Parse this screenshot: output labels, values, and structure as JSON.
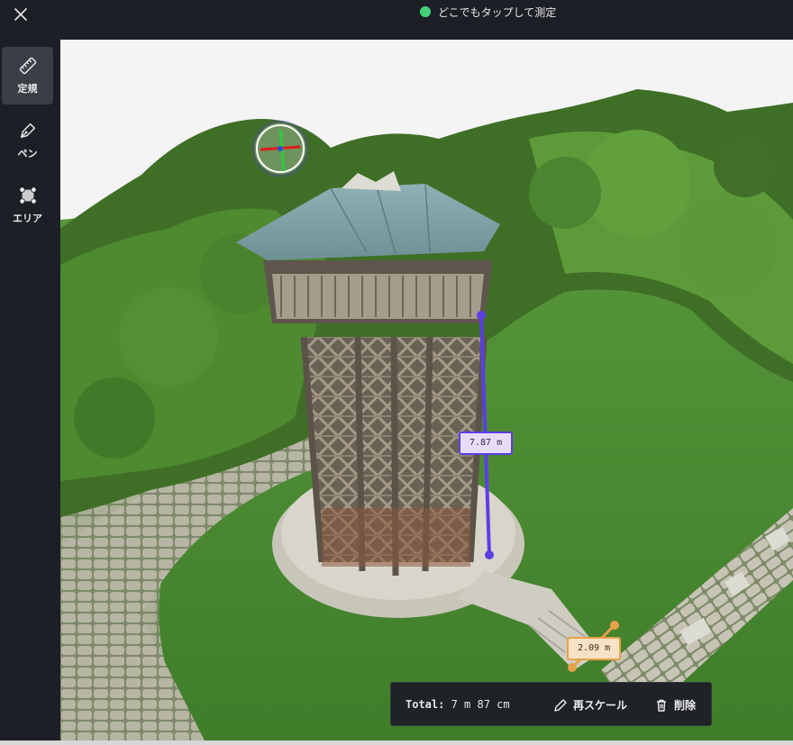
{
  "status": {
    "text": "どこでもタップして測定",
    "indicator_color": "#43d17a"
  },
  "sidebar": {
    "tools": [
      {
        "label": "定規",
        "icon": "ruler-icon",
        "active": true
      },
      {
        "label": "ペン",
        "icon": "pen-icon",
        "active": false
      },
      {
        "label": "エリア",
        "icon": "area-icon",
        "active": false
      }
    ]
  },
  "measurements": {
    "primary": {
      "label": "7.87 m",
      "color": "#5a3ee6"
    },
    "secondary": {
      "label": "2.09 m",
      "color": "#e6a24a"
    }
  },
  "toolbar": {
    "total_label": "Total:",
    "total_value": "7 m 87 cm",
    "rescale_label": "再スケール",
    "delete_label": "削除"
  }
}
